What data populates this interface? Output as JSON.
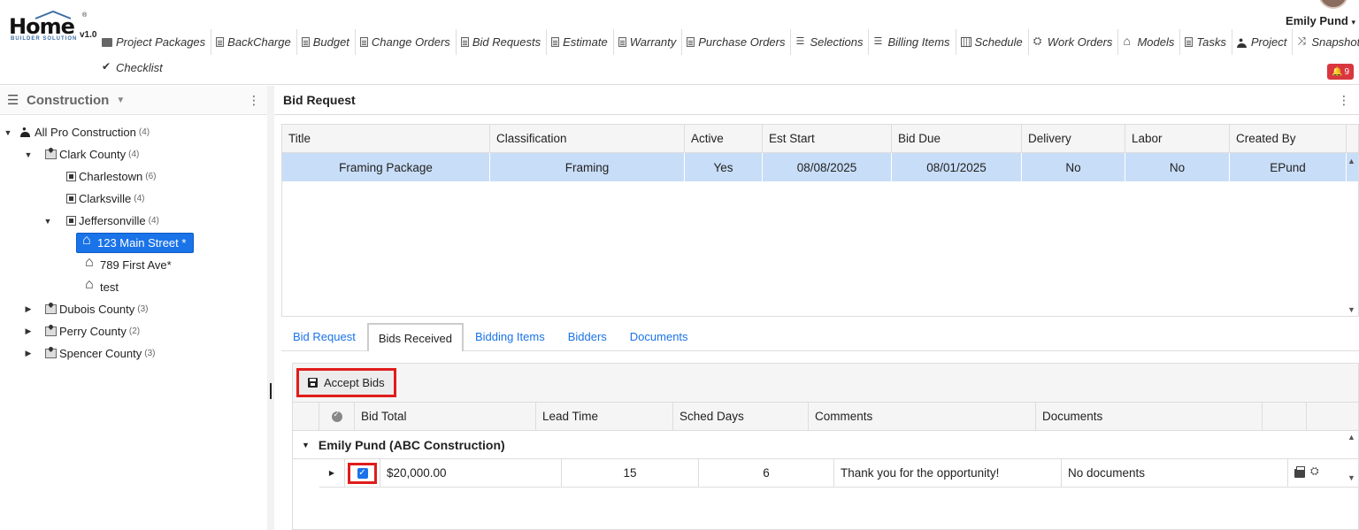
{
  "app": {
    "logo_text": "Home",
    "logo_sub": "BUILDER SOLUTION",
    "version": "v1.0",
    "logo_reg": "®"
  },
  "user": {
    "name": "Emily Pund",
    "notifications_count": "9"
  },
  "nav": {
    "row1": [
      {
        "label": "Project Packages",
        "icon": "package-icon"
      },
      {
        "label": "BackCharge",
        "icon": "document-icon"
      },
      {
        "label": "Budget",
        "icon": "document-icon"
      },
      {
        "label": "Change Orders",
        "icon": "document-icon"
      },
      {
        "label": "Bid Requests",
        "icon": "document-icon"
      },
      {
        "label": "Estimate",
        "icon": "document-icon"
      },
      {
        "label": "Warranty",
        "icon": "document-icon"
      },
      {
        "label": "Purchase Orders",
        "icon": "document-icon"
      },
      {
        "label": "Selections",
        "icon": "list-icon"
      },
      {
        "label": "Billing Items",
        "icon": "list-icon"
      },
      {
        "label": "Schedule",
        "icon": "calendar-icon"
      },
      {
        "label": "Work Orders",
        "icon": "crew-icon"
      },
      {
        "label": "Models",
        "icon": "home-icon"
      },
      {
        "label": "Tasks",
        "icon": "document-icon"
      },
      {
        "label": "Project",
        "icon": "user-icon"
      },
      {
        "label": "Snapshot",
        "icon": "shuffle-icon"
      }
    ],
    "row2": [
      {
        "label": "Checklist",
        "icon": "check-icon"
      }
    ]
  },
  "left_panel": {
    "title": "Construction",
    "tree": {
      "root": {
        "label": "All Pro Construction",
        "count": "(4)"
      },
      "clark": {
        "label": "Clark County",
        "count": "(4)"
      },
      "charlestown": {
        "label": "Charlestown",
        "count": "(6)"
      },
      "clarksville": {
        "label": "Clarksville",
        "count": "(4)"
      },
      "jeffersonville": {
        "label": "Jeffersonville",
        "count": "(4)"
      },
      "main_street": {
        "label": "123 Main Street *"
      },
      "first_ave": {
        "label": "789 First Ave*"
      },
      "test": {
        "label": "test"
      },
      "dubois": {
        "label": "Dubois County",
        "count": "(3)"
      },
      "perry": {
        "label": "Perry County",
        "count": "(2)"
      },
      "spencer": {
        "label": "Spencer County",
        "count": "(3)"
      }
    }
  },
  "right_panel": {
    "title": "Bid Request",
    "grid": {
      "headers": [
        "Title",
        "Classification",
        "Active",
        "Est Start",
        "Bid Due",
        "Delivery",
        "Labor",
        "Created By"
      ],
      "row": [
        "Framing Package",
        "Framing",
        "Yes",
        "08/08/2025",
        "08/01/2025",
        "No",
        "No",
        "EPund"
      ]
    },
    "tabs": [
      "Bid Request",
      "Bids Received",
      "Bidding Items",
      "Bidders",
      "Documents"
    ],
    "active_tab": "Bids Received",
    "bids": {
      "accept_label": "Accept Bids",
      "headers": [
        "Bid Total",
        "Lead Time",
        "Sched Days",
        "Comments",
        "Documents"
      ],
      "group_label": "Emily Pund (ABC Construction)",
      "row": {
        "accepted": true,
        "bid_total": "$20,000.00",
        "lead_time": "15",
        "sched_days": "6",
        "comments": "Thank you for the opportunity!",
        "documents": "No documents"
      }
    }
  },
  "colors": {
    "accent": "#1a73e8",
    "selected_row": "#c8ddf7",
    "highlight_red": "#e01c1c",
    "badge_red": "#d9363e"
  }
}
